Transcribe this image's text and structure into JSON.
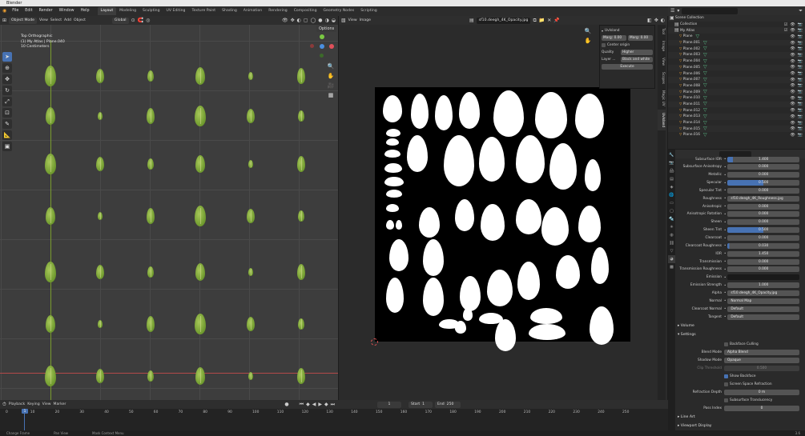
{
  "app": {
    "title": "Blender",
    "version": "3.6"
  },
  "menu": [
    "File",
    "Edit",
    "Render",
    "Window",
    "Help"
  ],
  "workspaces": [
    "Layout",
    "Modeling",
    "Sculpting",
    "UV Editing",
    "Texture Paint",
    "Shading",
    "Animation",
    "Rendering",
    "Compositing",
    "Geometry Nodes",
    "Scripting"
  ],
  "active_workspace": "Layout",
  "scene": {
    "label": "Scene",
    "view_layer": "ViewLayer"
  },
  "viewport3d": {
    "mode": "Object Mode",
    "menus": [
      "View",
      "Select",
      "Add",
      "Object"
    ],
    "orientation": "Global",
    "options": "Options",
    "info_line1": "Top Orthographic",
    "info_line2": "(1) My Atlas | Plane.040",
    "info_line3": "10 Centimeters"
  },
  "uv_editor": {
    "menus": [
      "View",
      "Image"
    ],
    "image_name": "sf10.deegh_4K_Opacity.jpg",
    "npanel": {
      "title": "UvIsland",
      "marg_label1": "Marg: 0.00",
      "marg_label2": "Marg: 0.00",
      "center_origin": "Center origin",
      "quality_label": "Quality",
      "quality_value": "Higher",
      "layer_label": "Layer ...",
      "layer_value": "Black and white",
      "execute": "Execute"
    },
    "side_tabs": [
      "Tool",
      "Image",
      "View",
      "Scopes",
      "Magic UV",
      "UvIsland"
    ]
  },
  "outliner": {
    "root": "Scene Collection",
    "collection": "Collection",
    "atlas": "My Atlas",
    "items": [
      "Plane",
      "Plane.001",
      "Plane.002",
      "Plane.003",
      "Plane.004",
      "Plane.005",
      "Plane.006",
      "Plane.007",
      "Plane.008",
      "Plane.009",
      "Plane.010",
      "Plane.011",
      "Plane.012",
      "Plane.013",
      "Plane.014",
      "Plane.015",
      "Plane.016"
    ]
  },
  "properties": {
    "rows": [
      {
        "label": "Subsurface IOR",
        "value": "1.400",
        "fill": 8
      },
      {
        "label": "Subsurface Anisotropy",
        "value": "0.000",
        "fill": 0
      },
      {
        "label": "Metallic",
        "value": "0.000",
        "fill": 0
      },
      {
        "label": "Specular",
        "value": "0.500",
        "fill": 50
      },
      {
        "label": "Specular Tint",
        "value": "0.000",
        "fill": 0
      },
      {
        "label": "Roughness",
        "value": "sf10.deegh_4K_Roughness.jpg",
        "fill": -1
      },
      {
        "label": "Anisotropic",
        "value": "0.000",
        "fill": 0
      },
      {
        "label": "Anisotropic Rotation",
        "value": "0.000",
        "fill": 0
      },
      {
        "label": "Sheen",
        "value": "0.000",
        "fill": 0
      },
      {
        "label": "Sheen Tint",
        "value": "0.500",
        "fill": 50
      },
      {
        "label": "Clearcoat",
        "value": "0.000",
        "fill": 0
      },
      {
        "label": "Clearcoat Roughness",
        "value": "0.030",
        "fill": 3
      },
      {
        "label": "IOR",
        "value": "1.450",
        "fill": 0
      },
      {
        "label": "Transmission",
        "value": "0.000",
        "fill": 0
      },
      {
        "label": "Transmission Roughness",
        "value": "0.000",
        "fill": 0
      },
      {
        "label": "Emission",
        "value": "",
        "fill": -2
      },
      {
        "label": "Emission Strength",
        "value": "1.000",
        "fill": 0
      },
      {
        "label": "Alpha",
        "value": "sf10.deegh_4K_Opacity.jpg",
        "fill": -1
      },
      {
        "label": "Normal",
        "value": "Normal Map",
        "fill": -1
      },
      {
        "label": "Clearcoat Normal",
        "value": "Default",
        "fill": -1
      },
      {
        "label": "Tangent",
        "value": "Default",
        "fill": -1
      }
    ],
    "volume": "Volume",
    "settings": "Settings",
    "backface_culling": "Backface Culling",
    "blend_mode_label": "Blend Mode",
    "blend_mode": "Alpha Blend",
    "shadow_mode_label": "Shadow Mode",
    "shadow_mode": "Opaque",
    "clip_threshold_label": "Clip Threshold",
    "clip_threshold": "0.500",
    "show_backface": "Show Backface",
    "screen_space_refraction": "Screen Space Refraction",
    "refraction_depth_label": "Refraction Depth",
    "refraction_depth": "0 m",
    "subsurface_translucency": "Subsurface Translucency",
    "pass_index_label": "Pass Index",
    "pass_index": "0",
    "line_art": "Line Art",
    "viewport_display": "Viewport Display"
  },
  "timeline": {
    "menus": [
      "Playback",
      "Keying",
      "View",
      "Marker"
    ],
    "current_frame": "1",
    "start_label": "Start",
    "start": "1",
    "end_label": "End",
    "end": "250",
    "frames": [
      "0",
      "10",
      "20",
      "30",
      "40",
      "50",
      "60",
      "70",
      "80",
      "90",
      "100",
      "110",
      "120",
      "130",
      "140",
      "150",
      "160",
      "170",
      "180",
      "190",
      "200",
      "210",
      "220",
      "230",
      "240",
      "250"
    ]
  },
  "status": [
    "Change Frame",
    "Pan View",
    "Mask Context Menu"
  ],
  "colors": {
    "accent": "#4772b3",
    "leaf": "#7fa83a",
    "orange": "#f0a030"
  }
}
